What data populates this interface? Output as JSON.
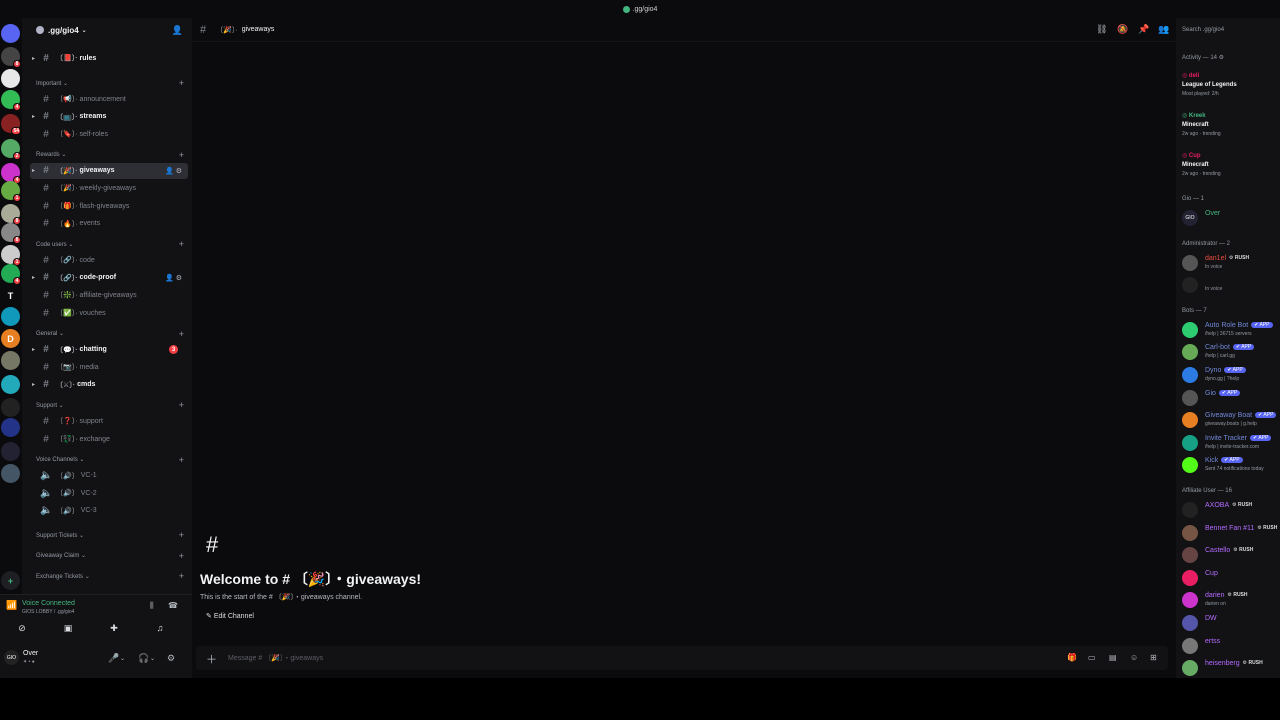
{
  "window": {
    "title": ".gg/gio4"
  },
  "server": {
    "name": ".gg/gio4"
  },
  "rail": [
    {
      "initial": "",
      "color": "#5865f2",
      "badge": ""
    },
    {
      "initial": "",
      "color": "#444",
      "badge": "8"
    },
    {
      "initial": "",
      "color": "#e8e8e8",
      "badge": ""
    },
    {
      "initial": "",
      "color": "#3b5",
      "badge": "4"
    },
    {
      "initial": "",
      "color": "#822",
      "badge": "54"
    },
    {
      "initial": "",
      "color": "#5a6",
      "badge": "2"
    },
    {
      "initial": "",
      "color": "#c3c",
      "badge": "4"
    },
    {
      "initial": "",
      "color": "#6a4",
      "badge": "1"
    },
    {
      "initial": "",
      "color": "#aa9",
      "badge": "8"
    },
    {
      "initial": "",
      "color": "#888",
      "badge": "8"
    },
    {
      "initial": "",
      "color": "#ccc",
      "badge": "1"
    },
    {
      "initial": "",
      "color": "#2a5",
      "badge": "4"
    },
    {
      "initial": "T",
      "color": "#0b0b0d",
      "badge": ""
    },
    {
      "initial": "",
      "color": "#19b",
      "badge": ""
    },
    {
      "initial": "D",
      "color": "#e67e22",
      "badge": ""
    },
    {
      "initial": "",
      "color": "#776",
      "badge": ""
    },
    {
      "initial": "",
      "color": "#2ab",
      "badge": ""
    },
    {
      "initial": "",
      "color": "#222",
      "badge": ""
    },
    {
      "initial": "",
      "color": "#238",
      "badge": ""
    },
    {
      "initial": "",
      "color": "#223",
      "badge": ""
    },
    {
      "initial": "",
      "color": "#456",
      "badge": ""
    }
  ],
  "sidebar": {
    "channels_top": [
      {
        "emoji": "📕",
        "name": "rules",
        "bold": true
      }
    ],
    "categories": [
      {
        "label": "Important",
        "channels": [
          {
            "emoji": "📢",
            "name": "announcement",
            "bold": false
          },
          {
            "emoji": "📺",
            "name": "streams",
            "bold": true
          },
          {
            "emoji": "🔖",
            "name": "self-roles",
            "bold": false
          }
        ]
      },
      {
        "label": "Rewards",
        "channels": [
          {
            "emoji": "🎉",
            "name": "giveaways",
            "bold": true,
            "active": true
          },
          {
            "emoji": "🎉",
            "name": "weekly-giveaways",
            "bold": false
          },
          {
            "emoji": "🎁",
            "name": "flash-giveaways",
            "bold": false
          },
          {
            "emoji": "🔥",
            "name": "events",
            "bold": false
          }
        ]
      },
      {
        "label": "Code users",
        "channels": [
          {
            "emoji": "🔗",
            "name": "code",
            "bold": false
          },
          {
            "emoji": "🔗",
            "name": "code-proof",
            "bold": true
          },
          {
            "emoji": "❇️",
            "name": "affiliate-giveaways",
            "bold": false
          },
          {
            "emoji": "✅",
            "name": "vouches",
            "bold": false
          }
        ]
      },
      {
        "label": "General",
        "channels": [
          {
            "emoji": "💬",
            "name": "chatting",
            "bold": true,
            "unread": "3"
          },
          {
            "emoji": "📷",
            "name": "media",
            "bold": false
          },
          {
            "emoji": "⚔",
            "name": "cmds",
            "bold": true
          }
        ]
      },
      {
        "label": "Support",
        "channels": [
          {
            "emoji": "❓",
            "name": "support",
            "bold": false
          },
          {
            "emoji": "💱",
            "name": "exchange",
            "bold": false
          }
        ]
      },
      {
        "label": "Voice Channels",
        "channels": [
          {
            "emoji": "🔊",
            "name": "VC-1",
            "bold": false
          },
          {
            "emoji": "🔊",
            "name": "VC-2",
            "bold": false
          },
          {
            "emoji": "🔊",
            "name": "VC-3",
            "bold": false
          }
        ]
      }
    ],
    "collapsed": [
      "Support Tickets",
      "Giveaway Claim",
      "Exchange Tickets"
    ]
  },
  "voice": {
    "status": "Voice Connected",
    "channel": "GIOS LOBBY / .gg/gio4"
  },
  "user": {
    "name": "Over",
    "avatar_text": "GIO"
  },
  "header": {
    "emoji": "🎉",
    "channel": "giveaways"
  },
  "search": {
    "placeholder": "Search .gg/gio4"
  },
  "welcome": {
    "title": "Welcome to # 〔🎉〕・giveaways!",
    "subtitle": "This is the start of the # 〔🎉〕・giveaways channel.",
    "edit": "Edit Channel"
  },
  "composer": {
    "placeholder": "Message # 〔🎉〕・giveaways"
  },
  "members": {
    "activity_header": "Activity — 14",
    "activity": [
      {
        "user": "deli",
        "user_color": "#e91e63",
        "game": "League of Legends",
        "meta": "Most played: 2/h"
      },
      {
        "user": "Kreek",
        "user_color": "#43b581",
        "game": "Minecraft",
        "meta": "2w ago · trending"
      },
      {
        "user": "Cup",
        "user_color": "#e91e63",
        "game": "Minecraft",
        "meta": "2w ago · trending"
      }
    ],
    "groups": [
      {
        "header": "Gio — 1",
        "items": [
          {
            "name": "Over",
            "color": "#43b581",
            "status": "",
            "avatar": "#223",
            "av_text": "GIO"
          }
        ]
      },
      {
        "header": "Administrator — 2",
        "items": [
          {
            "name": "dan1el",
            "color": "#e74c3c",
            "status": "In voice",
            "avatar": "#555",
            "rush": "RUSH"
          },
          {
            "name": "",
            "color": "#e74c3c",
            "status": "In voice",
            "avatar": "#222"
          }
        ]
      },
      {
        "header": "Bots — 7",
        "items": [
          {
            "name": "Auto Role Bot",
            "color": "#7289da",
            "status": "/help | 36715 servers",
            "avatar": "#2ecc71",
            "tag": "APP"
          },
          {
            "name": "Carl-bot",
            "color": "#7289da",
            "status": "/help | carl.gg",
            "avatar": "#6a5",
            "tag": "APP"
          },
          {
            "name": "Dyno",
            "color": "#7289da",
            "status": "dyno.gg | ?help",
            "avatar": "#2c7be5",
            "tag": "APP"
          },
          {
            "name": "Gio",
            "color": "#7289da",
            "status": "",
            "avatar": "#555",
            "tag": "APP"
          },
          {
            "name": "Giveaway Boat",
            "color": "#7289da",
            "status": "giveaway.boats | g.help",
            "avatar": "#e67e22",
            "tag": "APP"
          },
          {
            "name": "Invite Tracker",
            "color": "#7289da",
            "status": "/help | invite-tracker.com",
            "avatar": "#16a085",
            "tag": "APP"
          },
          {
            "name": "Kick",
            "color": "#7289da",
            "status": "Sent 74 notifications today",
            "avatar": "#53fc18",
            "tag": "APP"
          }
        ]
      },
      {
        "header": "Affiliate User — 16",
        "items": [
          {
            "name": "AXOBA",
            "color": "#b36bff",
            "status": "",
            "avatar": "#222",
            "rush": "RUSH"
          },
          {
            "name": "Bennet Fan #11",
            "color": "#b36bff",
            "status": "",
            "avatar": "#754",
            "rush": "RUSH"
          },
          {
            "name": "Castello",
            "color": "#b36bff",
            "status": "",
            "avatar": "#644",
            "rush": "RUSH"
          },
          {
            "name": "Cup",
            "color": "#b36bff",
            "status": "",
            "avatar": "#e91e63"
          },
          {
            "name": "darien",
            "color": "#b36bff",
            "status": "darien on",
            "avatar": "#c3c",
            "rush": "RUSH"
          },
          {
            "name": "DW",
            "color": "#b36bff",
            "status": "",
            "avatar": "#55a"
          },
          {
            "name": "ertss",
            "color": "#b36bff",
            "status": "",
            "avatar": "#777"
          },
          {
            "name": "heisenberg",
            "color": "#b36bff",
            "status": "",
            "avatar": "#6a6",
            "rush": "RUSH"
          }
        ]
      }
    ]
  }
}
